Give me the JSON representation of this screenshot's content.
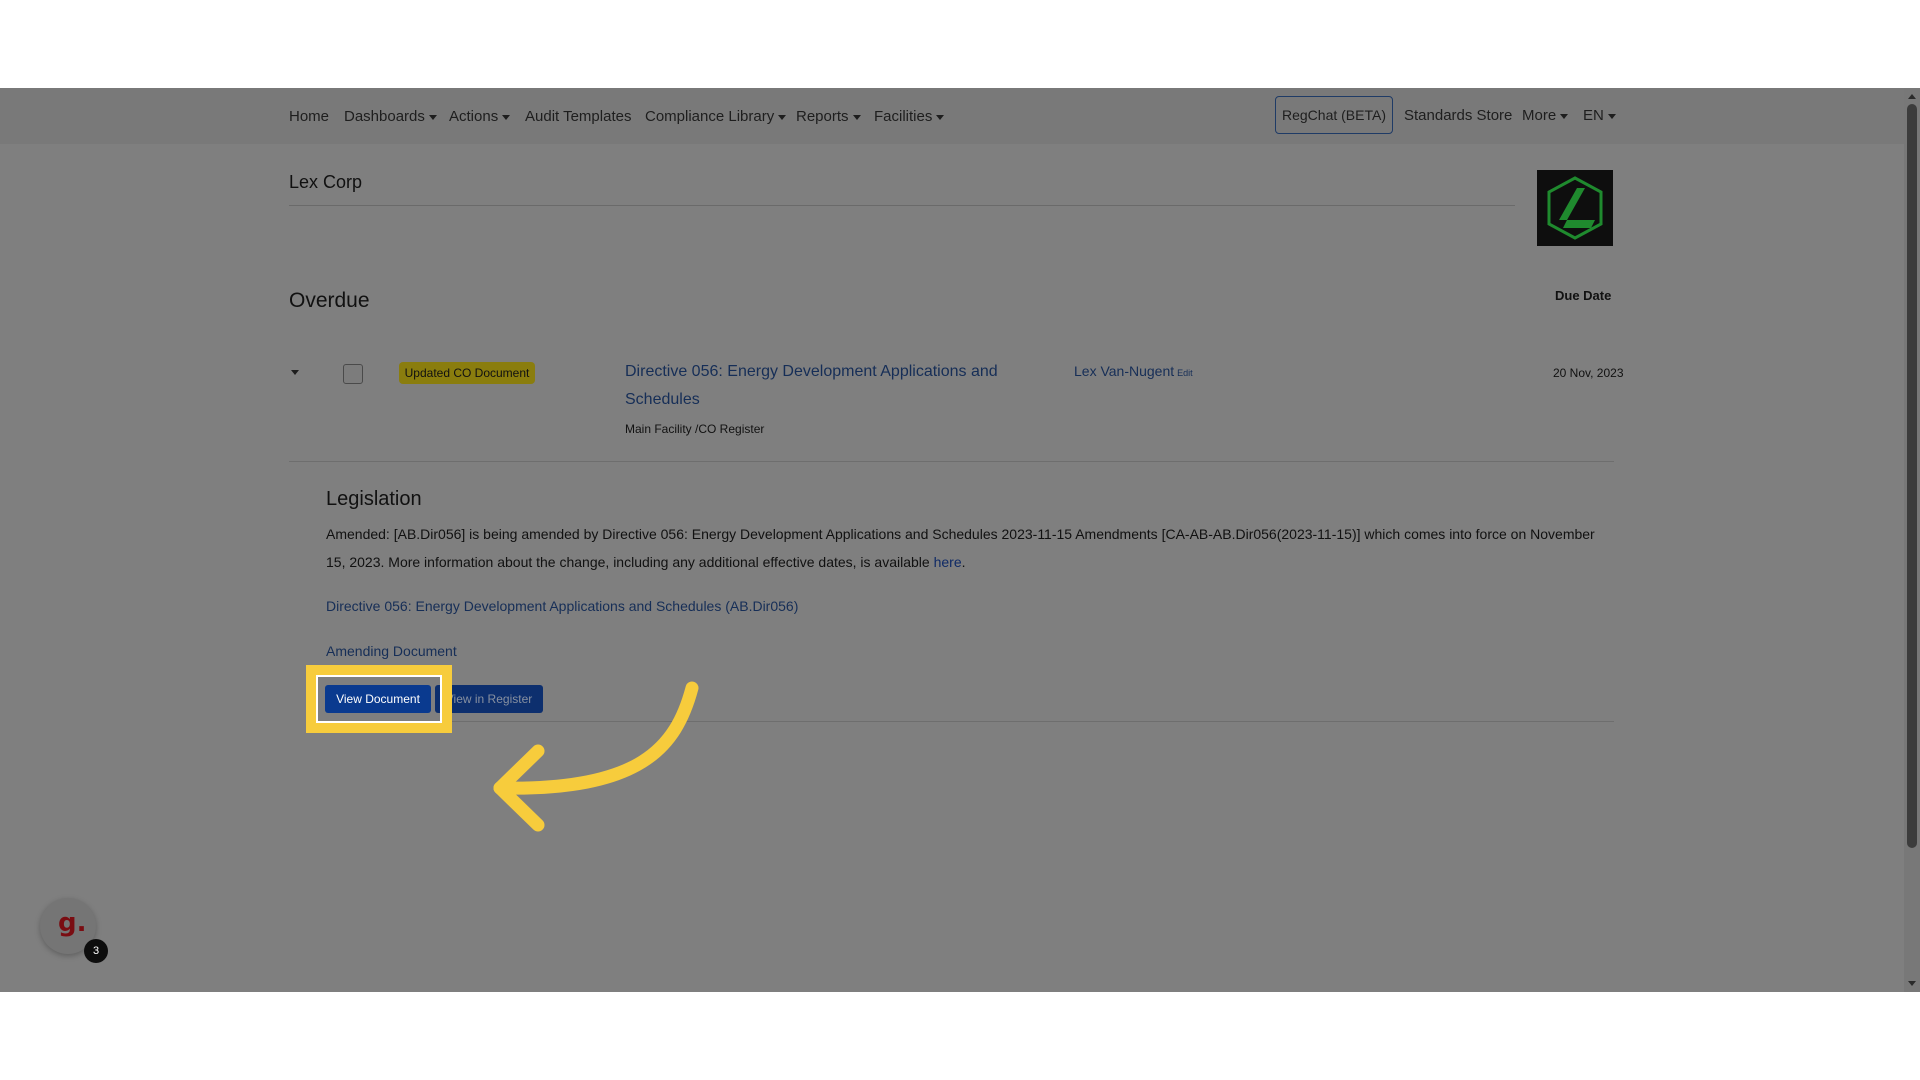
{
  "nav": {
    "items": [
      {
        "label": "Home",
        "dropdown": false
      },
      {
        "label": "Dashboards",
        "dropdown": true
      },
      {
        "label": "Actions",
        "dropdown": true
      },
      {
        "label": "Audit Templates",
        "dropdown": false
      },
      {
        "label": "Compliance Library",
        "dropdown": true
      },
      {
        "label": "Reports",
        "dropdown": true
      },
      {
        "label": "Facilities",
        "dropdown": true
      }
    ],
    "regchat": "RegChat (BETA)",
    "standards_store": "Standards Store",
    "more": "More",
    "language": "EN"
  },
  "company": {
    "name": "Lex Corp",
    "logo_icon": "lex-corp-logo"
  },
  "section": {
    "title": "Overdue",
    "due_date_header": "Due Date"
  },
  "row": {
    "badge": "Updated CO Document",
    "badge_color": "#8a7d0e",
    "title": "Directive 056: Energy Development Applications and Schedules",
    "subtitle": "Main Facility /CO Register",
    "assignee": "Lex Van-Nugent",
    "edit_label": "Edit",
    "due_date": "20 Nov, 2023"
  },
  "legislation": {
    "heading": "Legislation",
    "body": "Amended: [AB.Dir056] is being amended by Directive 056: Energy Development Applications and Schedules 2023-11-15 Amendments [CA-AB-AB.Dir056(2023-11-15)] which comes into force on November 15, 2023. More information about the change, including any additional effective dates, is available ",
    "here_link": "here",
    "body_end": ".",
    "directive_link": "Directive 056: Energy Development Applications and Schedules (AB.Dir056)",
    "amending_link": "Amending Document",
    "view_document": "View Document",
    "view_in_register": "View in Register"
  },
  "highlight": {
    "color": "#f7cc3c"
  },
  "widget": {
    "letter": "g.",
    "count": "3"
  }
}
